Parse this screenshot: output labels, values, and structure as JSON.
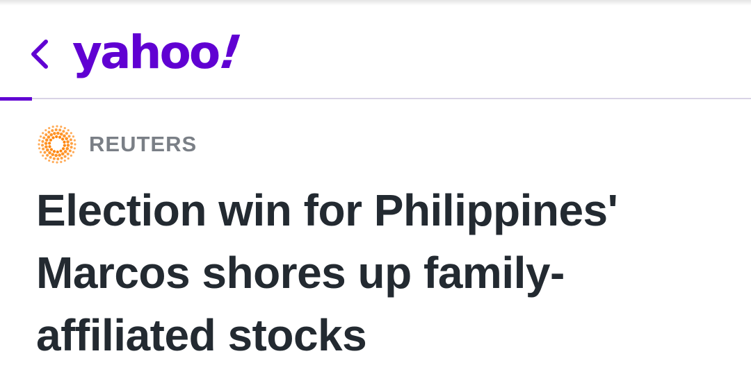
{
  "header": {
    "back_icon": "chevron-left-icon",
    "logo_text": "yahoo",
    "logo_mark": "!",
    "brand_color": "#6001d2"
  },
  "article": {
    "source": {
      "logo_icon": "reuters-dot-ring-icon",
      "name": "REUTERS",
      "accent_color": "#ff8000"
    },
    "headline": "Election win for Philippines' Marcos shores up family-affiliated stocks"
  }
}
